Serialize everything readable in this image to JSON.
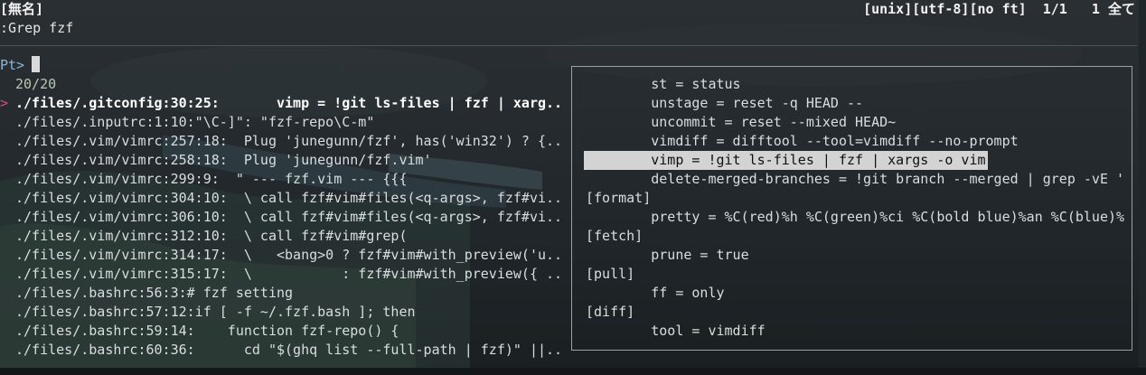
{
  "statusline": {
    "left": "[無名]",
    "right": "[unix][utf-8][no ft]  1/1   1 全て"
  },
  "command_line": ":Grep fzf",
  "prompt": {
    "label": "Pt>",
    "query": ""
  },
  "match_count": "20/20",
  "selected_index": 0,
  "results": [
    "./files/.gitconfig:30:25:       vimp = !git ls-files | fzf | xarg..",
    "./files/.inputrc:1:10:\"\\C-]\": \"fzf-repo\\C-m\"",
    "./files/.vim/vimrc:257:18:  Plug 'junegunn/fzf', has('win32') ? {..",
    "./files/.vim/vimrc:258:18:  Plug 'junegunn/fzf.vim'",
    "./files/.vim/vimrc:299:9:  \" --- fzf.vim --- {{{",
    "./files/.vim/vimrc:304:10:  \\ call fzf#vim#files(<q-args>, fzf#vi..",
    "./files/.vim/vimrc:306:10:  \\ call fzf#vim#files(<q-args>, fzf#vi..",
    "./files/.vim/vimrc:312:10:  \\ call fzf#vim#grep(",
    "./files/.vim/vimrc:314:17:  \\   <bang>0 ? fzf#vim#with_preview('u..",
    "./files/.vim/vimrc:315:17:  \\           : fzf#vim#with_preview({ ..",
    "./files/.bashrc:56:3:# fzf setting",
    "./files/.bashrc:57:12:if [ -f ~/.fzf.bash ]; then",
    "./files/.bashrc:59:14:    function fzf-repo() {",
    "./files/.bashrc:60:36:      cd \"$(ghq list --full-path | fzf)\" ||.."
  ],
  "preview": {
    "highlighted_index": 4,
    "lines": [
      "        st = status",
      "        unstage = reset -q HEAD --",
      "        uncommit = reset --mixed HEAD~",
      "        vimdiff = difftool --tool=vimdiff --no-prompt",
      "        vimp = !git ls-files | fzf | xargs -o vim",
      "        delete-merged-branches = !git branch --merged | grep -vE '",
      "[format]",
      "        pretty = %C(red)%h %C(green)%ci %C(bold blue)%an %C(blue)%",
      "[fetch]",
      "        prune = true",
      "[pull]",
      "        ff = only",
      "[diff]",
      "        tool = vimdiff"
    ]
  },
  "colors": {
    "background": "#1e2326",
    "selection_marker": "#e04a7a",
    "prompt": "#8fb4d8",
    "highlight_bg": "#d3d3d3"
  }
}
